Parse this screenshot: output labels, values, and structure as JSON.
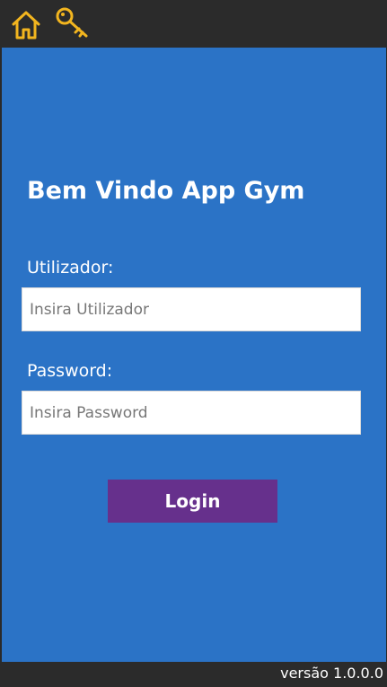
{
  "topbar": {
    "home_icon": "home-icon",
    "key_icon": "key-icon",
    "icon_color": "#f2b51f"
  },
  "main": {
    "title": "Bem Vindo App Gym",
    "username_label": "Utilizador:",
    "username_placeholder": "Insira Utilizador",
    "username_value": "",
    "password_label": "Password:",
    "password_placeholder": "Insira Password",
    "password_value": "",
    "login_label": "Login"
  },
  "footer": {
    "version": "versão 1.0.0.0"
  },
  "colors": {
    "background": "#2b73c6",
    "bar": "#2b2b2b",
    "button": "#66308c",
    "text": "#ffffff"
  }
}
